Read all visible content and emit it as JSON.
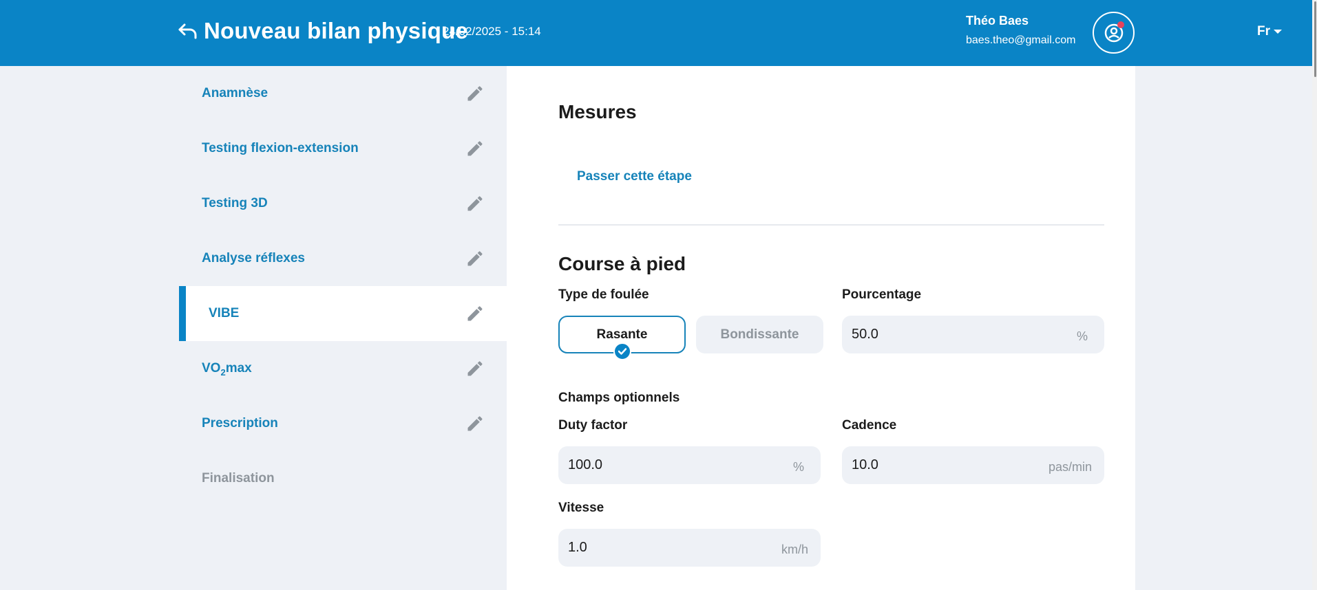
{
  "header": {
    "title": "Nouveau bilan physique",
    "datetime": "24/02/2025 - 15:14",
    "user_name": "Théo Baes",
    "user_email": "baes.theo@gmail.com",
    "language": "Fr",
    "bg_color": "#0a84c6"
  },
  "sidebar": {
    "items": [
      {
        "label": "Anamnèse",
        "state": "done"
      },
      {
        "label": "Testing flexion-extension",
        "state": "done"
      },
      {
        "label": "Testing 3D",
        "state": "done"
      },
      {
        "label": "Analyse réflexes",
        "state": "done"
      },
      {
        "label": "VIBE",
        "state": "active"
      },
      {
        "label_main": "VO",
        "label_sub": "2",
        "label_tail": "max",
        "state": "done"
      },
      {
        "label": "Prescription",
        "state": "done"
      },
      {
        "label": "Finalisation",
        "state": "disabled"
      }
    ],
    "accent_color": "#1683b9"
  },
  "main": {
    "mesures": {
      "heading": "Mesures",
      "skip_label": "Passer cette étape"
    },
    "course": {
      "heading": "Course à pied",
      "stride_label": "Type de foulée",
      "stride_options": [
        "Rasante",
        "Bondissante"
      ],
      "stride_selected": "Rasante",
      "percentage_label": "Pourcentage",
      "percentage_value": "50.0",
      "percentage_unit": "%",
      "optional_label": "Champs optionnels",
      "duty_label": "Duty factor",
      "duty_value": "100.0",
      "duty_unit": "%",
      "cadence_label": "Cadence",
      "cadence_value": "10.0",
      "cadence_unit": "pas/min",
      "speed_label": "Vitesse",
      "speed_value": "1.0",
      "speed_unit": "km/h"
    }
  }
}
